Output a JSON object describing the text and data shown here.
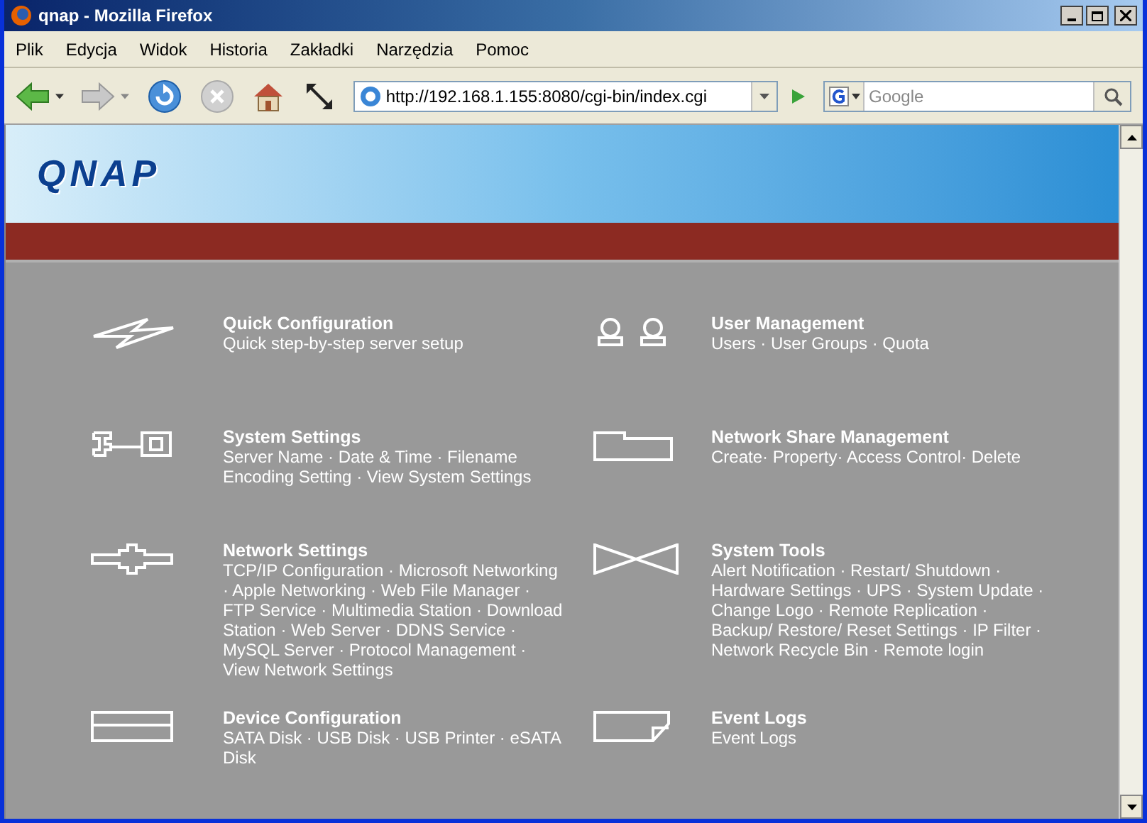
{
  "window": {
    "title": "qnap - Mozilla Firefox"
  },
  "menu": [
    "Plik",
    "Edycja",
    "Widok",
    "Historia",
    "Zakładki",
    "Narzędzia",
    "Pomoc"
  ],
  "address": {
    "value": "http://192.168.1.155:8080/cgi-bin/index.cgi"
  },
  "search": {
    "placeholder": "Google"
  },
  "logo": "QNAP",
  "sections": [
    {
      "kind": "bolt",
      "title": "Quick Configuration",
      "links": "Quick step-by-step server setup"
    },
    {
      "kind": "users",
      "title": "User Management",
      "links": "Users · User Groups · Quota"
    },
    {
      "kind": "wrench",
      "title": "System Settings",
      "links": "Server Name · Date & Time · Filename Encoding Setting · View System Settings"
    },
    {
      "kind": "folder",
      "title": "Network Share Management",
      "links": "Create· Property· Access Control· Delete"
    },
    {
      "kind": "network",
      "title": "Network Settings",
      "links": "TCP/IP Configuration · Microsoft Networking · Apple Networking · Web File Manager · FTP Service · Multimedia Station · Download Station · Web Server · DDNS Service · MySQL Server · Protocol Management · View Network Settings"
    },
    {
      "kind": "tools",
      "title": "System Tools",
      "links": "Alert Notification · Restart/ Shutdown · Hardware Settings · UPS · System Update · Change Logo · Remote Replication · Backup/ Restore/ Reset Settings · IP Filter · Network Recycle Bin · Remote login"
    },
    {
      "kind": "device",
      "title": "Device Configuration",
      "links": "SATA Disk · USB Disk · USB Printer · eSATA Disk"
    },
    {
      "kind": "log",
      "title": "Event Logs",
      "links": "Event Logs"
    }
  ]
}
